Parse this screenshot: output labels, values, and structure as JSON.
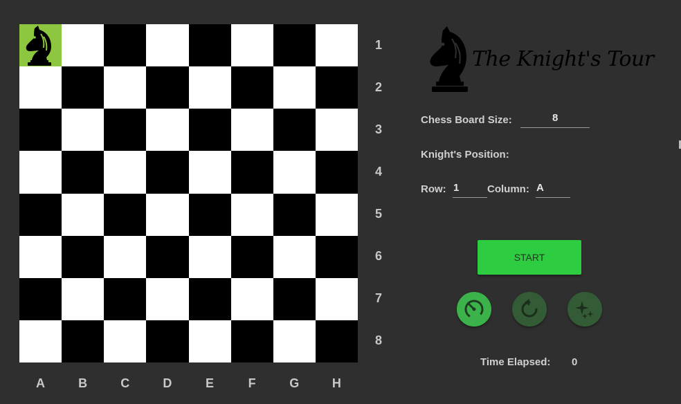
{
  "board": {
    "size": 8,
    "knight_square": "A1",
    "row_labels": [
      "1",
      "2",
      "3",
      "4",
      "5",
      "6",
      "7",
      "8"
    ],
    "column_labels": [
      "A",
      "B",
      "C",
      "D",
      "E",
      "F",
      "G",
      "H"
    ],
    "colors": {
      "light": "#ffffff",
      "dark": "#000000",
      "knight_highlight": "#8dc63f"
    }
  },
  "header": {
    "title": "The Knight's Tour",
    "logo_icon": "knight-icon"
  },
  "settings": {
    "board_size_label": "Chess Board Size:",
    "board_size_value": "8",
    "knight_position_label": "Knight's Position:",
    "row_label": "Row:",
    "row_value": "1",
    "column_label": "Column:",
    "column_value": "A"
  },
  "controls": {
    "start_label": "START",
    "speed_icon": "speedometer-icon",
    "reset_icon": "rotate-icon",
    "magic_icon": "sparkles-icon",
    "accent_color": "#2ecc40"
  },
  "status": {
    "time_label": "Time Elapsed:",
    "time_value": "0"
  }
}
